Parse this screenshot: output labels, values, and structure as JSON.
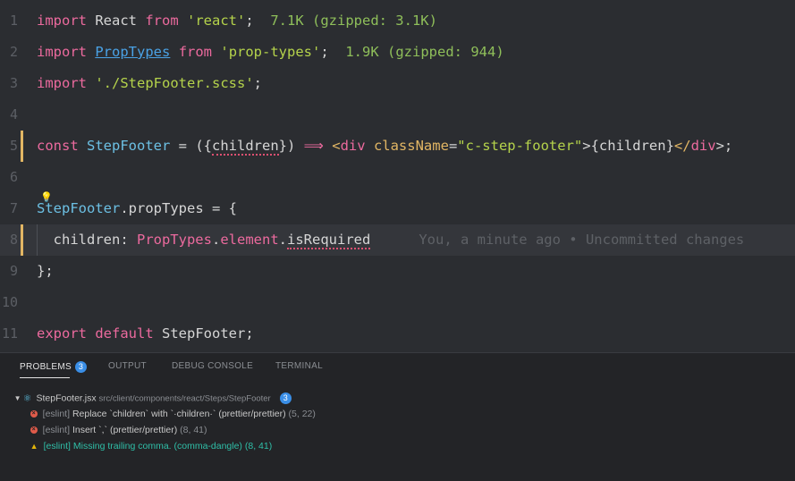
{
  "editor": {
    "lines": [
      {
        "n": "1",
        "seg": [
          "import",
          " React ",
          "from",
          " ",
          "'react'",
          ";",
          "  7.1K (gzipped: 3.1K)"
        ]
      },
      {
        "n": "2",
        "seg": [
          "import",
          " ",
          "PropTypes",
          " ",
          "from",
          " ",
          "'prop-types'",
          ";",
          "  1.9K (gzipped: 944)"
        ]
      },
      {
        "n": "3",
        "seg": [
          "import",
          " ",
          "'./StepFooter.scss'",
          ";"
        ]
      },
      {
        "n": "4",
        "seg": []
      },
      {
        "n": "5",
        "seg": [
          "const",
          " ",
          "StepFooter",
          " = ({",
          "children",
          "}) ",
          "⟹",
          " ",
          "<",
          "div",
          " ",
          "className",
          "=",
          "\"c-step-footer\"",
          ">{children}",
          "</",
          "div",
          ">;"
        ]
      },
      {
        "n": "6",
        "seg": []
      },
      {
        "n": "7",
        "seg": [
          "StepFooter",
          ".propTypes = {"
        ]
      },
      {
        "n": "8",
        "seg": [
          "  children: ",
          "PropTypes",
          ".",
          "element",
          ".",
          "isRequired"
        ],
        "blame": "You, a minute ago • Uncommitted changes"
      },
      {
        "n": "9",
        "seg": [
          "};"
        ]
      },
      {
        "n": "10",
        "seg": []
      },
      {
        "n": "11",
        "seg": [
          "export",
          " ",
          "default",
          " StepFooter;"
        ]
      }
    ],
    "lightbulb_icon": "lightbulb-icon"
  },
  "panel": {
    "tabs": [
      {
        "label": "PROBLEMS",
        "badge": "3"
      },
      {
        "label": "OUTPUT"
      },
      {
        "label": "DEBUG CONSOLE"
      },
      {
        "label": "TERMINAL"
      }
    ],
    "file": {
      "name": "StepFooter.jsx",
      "path": "src/client/components/react/Steps/StepFooter",
      "count": "3"
    },
    "problems": [
      {
        "type": "error",
        "source": "[eslint]",
        "message": "Replace `children` with `·children·` (prettier/prettier)",
        "loc": "(5, 22)"
      },
      {
        "type": "error",
        "source": "[eslint]",
        "message": "Insert `,` (prettier/prettier)",
        "loc": "(8, 41)"
      },
      {
        "type": "warning",
        "source": "[eslint]",
        "message": "Missing trailing comma. (comma-dangle)",
        "loc": "(8, 41)"
      }
    ]
  },
  "colors": {
    "background": "#2b2d31",
    "keyword": "#ec6a9e",
    "string": "#b5d34b",
    "identifier": "#6cc0e4",
    "attribute": "#e2b664",
    "error": "#e05b4a",
    "warning": "#e2b40a",
    "accent": "#3a8ee6"
  }
}
